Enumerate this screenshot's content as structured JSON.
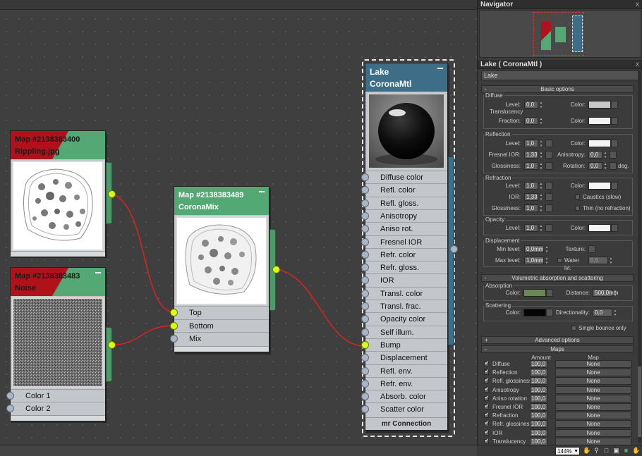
{
  "navigator": {
    "title": "Navigator",
    "close": "x"
  },
  "material_panel": {
    "title": "Lake  ( CoronaMtl )",
    "close": "x",
    "name_value": "Lake",
    "basic_options": {
      "header": "Basic options",
      "diffuse_label": "Diffuse",
      "level_label": "Level:",
      "diffuse_level": "0,0",
      "color_label": "Color:",
      "diffuse_color": "#c8c8c8",
      "translucency_label": "Translucency",
      "fraction_label": "Fraction:",
      "fraction_value": "0,0",
      "translucency_color": "#f4f4f4",
      "reflection_label": "Reflection",
      "refl_level": "1,0",
      "refl_color": "#f4f4f4",
      "fresnel_label": "Fresnel IOR:",
      "fresnel_value": "1,33",
      "anisotropy_label": "Anisotropy:",
      "anisotropy_value": "0,0",
      "glossiness_label": "Glossiness:",
      "refl_gloss": "1,0",
      "rotation_label": "Rotation:",
      "rotation_value": "0,0",
      "deg_label": "deg.",
      "refraction_label": "Refraction",
      "refr_level": "1,0",
      "refr_color": "#f4f4f4",
      "ior_label": "IOR:",
      "ior_value": "1,33",
      "caustics_label": "Caustics (slow)",
      "refr_gloss": "1,0",
      "thin_label": "Thin (no refraction)",
      "opacity_label": "Opacity",
      "opacity_level": "1,0",
      "opacity_color": "#f4f4f4",
      "displacement_label": "Displacement",
      "min_level_label": "Min level:",
      "min_level_value": "0,0mm",
      "texture_label": "Texture:",
      "max_level_label": "Max level:",
      "max_level_value": "1,0mm",
      "water_label": "Water lvl.",
      "water_value": "0,5"
    },
    "volumetric": {
      "header": "Volumetric absorption and scattering",
      "absorption_label": "Absorption",
      "color_label": "Color:",
      "absorption_color": "#6b8753",
      "distance_label": "Distance:",
      "distance_value": "500,0mm",
      "scattering_label": "Scattering",
      "scatter_color": "#050505",
      "directionality_label": "Directionality:",
      "directionality_value": "0,0",
      "single_bounce_label": "Single bounce only"
    },
    "advanced": {
      "header": "Advanced options"
    },
    "maps": {
      "header": "Maps",
      "col_amount": "Amount",
      "col_map": "Map",
      "rows": [
        {
          "name": "Diffuse",
          "amount": "100,0",
          "map": "None"
        },
        {
          "name": "Reflection",
          "amount": "100,0",
          "map": "None"
        },
        {
          "name": "Refl. glossiness",
          "amount": "100,0",
          "map": "None"
        },
        {
          "name": "Anisotropy",
          "amount": "100,0",
          "map": "None"
        },
        {
          "name": "Aniso rotation",
          "amount": "100,0",
          "map": "None"
        },
        {
          "name": "Fresnel IOR",
          "amount": "100,0",
          "map": "None"
        },
        {
          "name": "Refraction",
          "amount": "100,0",
          "map": "None"
        },
        {
          "name": "Refr. glossiness",
          "amount": "100,0",
          "map": "None"
        },
        {
          "name": "IOR",
          "amount": "100,0",
          "map": "None"
        },
        {
          "name": "Translucency",
          "amount": "100,0",
          "map": "None"
        }
      ]
    }
  },
  "nodes": {
    "rippling": {
      "line1": "Map #2138383400",
      "line2": "Rippling.jpg"
    },
    "noise": {
      "line1": "Map #2138383483",
      "line2": "Noise",
      "sockets": [
        "Color 1",
        "Color 2"
      ]
    },
    "coronamix": {
      "line1": "Map #2138383489",
      "line2": "CoronaMix",
      "sockets": [
        "Top",
        "Bottom",
        "Mix"
      ]
    },
    "lake": {
      "line1": "Lake",
      "line2": "CoronaMtl",
      "sockets": [
        "Diffuse color",
        "Refl. color",
        "Refl. gloss.",
        "Anisotropy",
        "Aniso rot.",
        "Fresnel IOR",
        "Refr. color",
        "Refr. gloss.",
        "IOR",
        "Transl. color",
        "Transl. frac.",
        "Opacity color",
        "Self illum.",
        "Bump",
        "Displacement",
        "Refl. env.",
        "Refr. env.",
        "Absorb. color",
        "Scatter color"
      ],
      "footer": "mr Connection"
    }
  },
  "statusbar": {
    "zoom": "144%"
  }
}
